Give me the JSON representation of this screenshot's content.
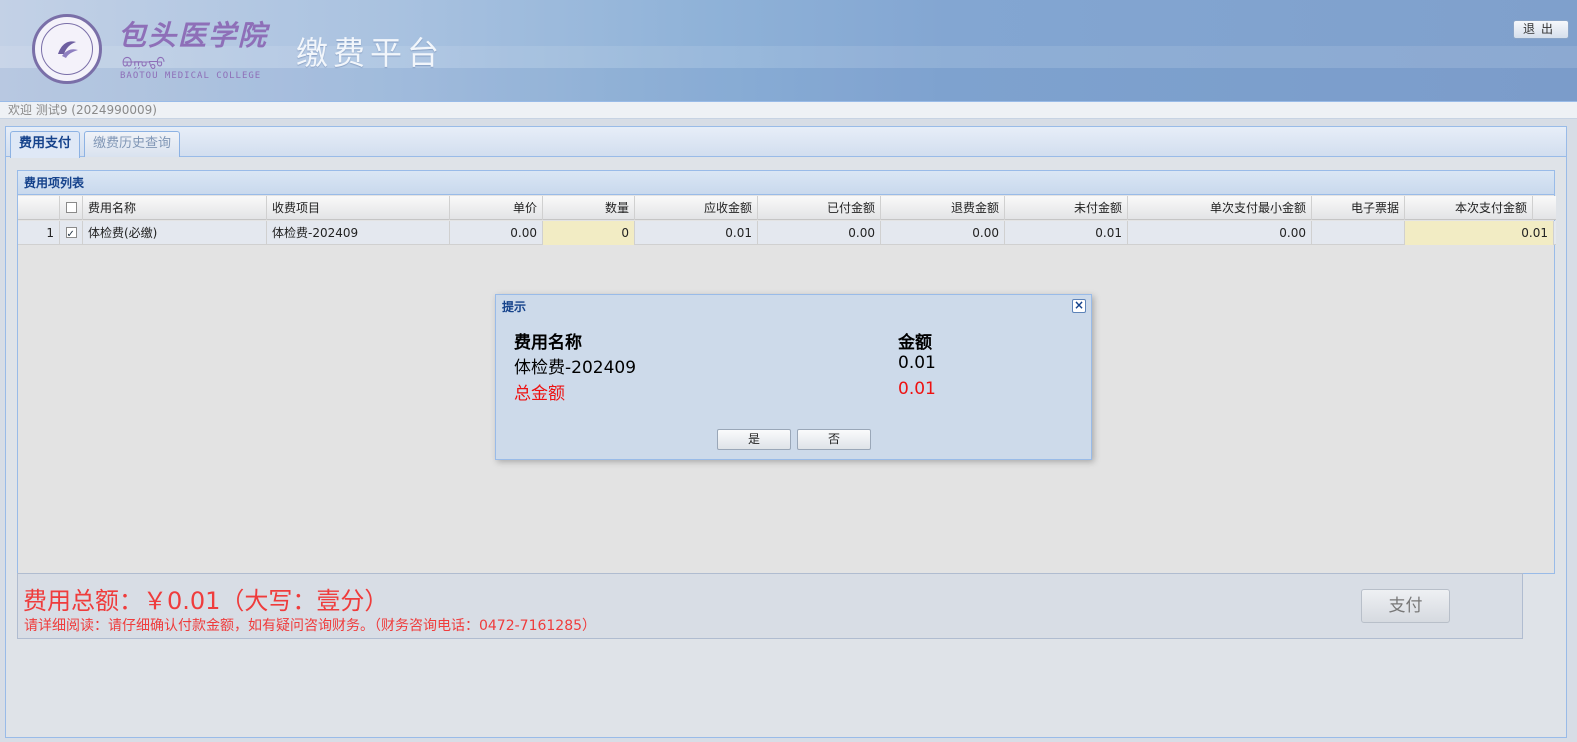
{
  "header": {
    "logo_cn": "包头医学院",
    "logo_mongolian": "ᠪᠣᠭᠣᠲᠣ",
    "logo_en": "BAOTOU MEDICAL COLLEGE",
    "platform_title": "缴费平台",
    "logout_label": "退出"
  },
  "welcome_text": "欢迎 测试9 (2024990009)",
  "tabs": [
    {
      "label": "费用支付",
      "active": true
    },
    {
      "label": "缴费历史查询",
      "active": false
    }
  ],
  "grid": {
    "title": "费用项列表",
    "columns": [
      "费用名称",
      "收费项目",
      "单价",
      "数量",
      "应收金额",
      "已付金额",
      "退费金额",
      "未付金额",
      "单次支付最小金额",
      "电子票据",
      "本次支付金额"
    ],
    "rows": [
      {
        "index": "1",
        "checked": true,
        "name": "体检费(必缴)",
        "item": "体检费-202409",
        "unit_price": "0.00",
        "quantity": "0",
        "receivable": "0.01",
        "paid": "0.00",
        "refund": "0.00",
        "unpaid": "0.01",
        "min_payment": "0.00",
        "e_invoice": "",
        "this_payment": "0.01"
      }
    ]
  },
  "summary": {
    "total_text": "费用总额：￥0.01（大写：壹分）",
    "notice_text": "请详细阅读：请仔细确认付款金额，如有疑问咨询财务。（财务咨询电话：0472-7161285）",
    "pay_label": "支付"
  },
  "dialog": {
    "title": "提示",
    "header_name": "费用名称",
    "header_amount": "金额",
    "item_name": "体检费-202409",
    "item_amount": "0.01",
    "total_label": "总金额",
    "total_amount": "0.01",
    "yes_label": "是",
    "no_label": "否"
  },
  "colors": {
    "accent": "#15428b",
    "warning_red": "#ef3c3c",
    "editable_cell": "#f2ecc4"
  }
}
